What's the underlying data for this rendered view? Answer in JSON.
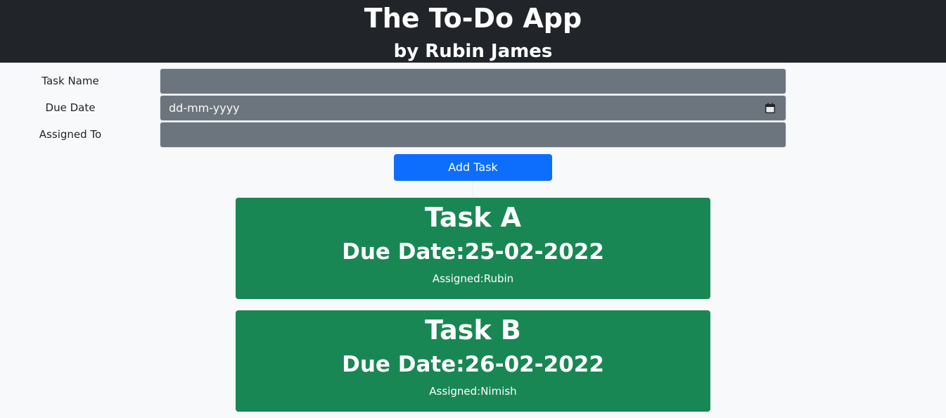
{
  "header": {
    "title": "The To-Do App",
    "subtitle": "by Rubin James"
  },
  "form": {
    "task_name_label": "Task Name",
    "task_name_value": "",
    "due_date_label": "Due Date",
    "due_date_placeholder": "dd-mm-yyyy",
    "assigned_to_label": "Assigned To",
    "assigned_to_value": "",
    "add_button_label": "Add Task"
  },
  "tasks": [
    {
      "name": "Task A",
      "due_prefix": "Due Date:",
      "due_date": "25-02-2022",
      "assigned_prefix": "Assigned:",
      "assigned": "Rubin"
    },
    {
      "name": "Task B",
      "due_prefix": "Due Date:",
      "due_date": "26-02-2022",
      "assigned_prefix": "Assigned:",
      "assigned": "Nimish"
    }
  ],
  "colors": {
    "header_bg": "#212529",
    "input_bg": "#6c757d",
    "button_bg": "#0d6efd",
    "card_bg": "#198754",
    "page_bg": "#f8f9fa"
  },
  "icons": {
    "date_picker": "calendar-icon"
  }
}
